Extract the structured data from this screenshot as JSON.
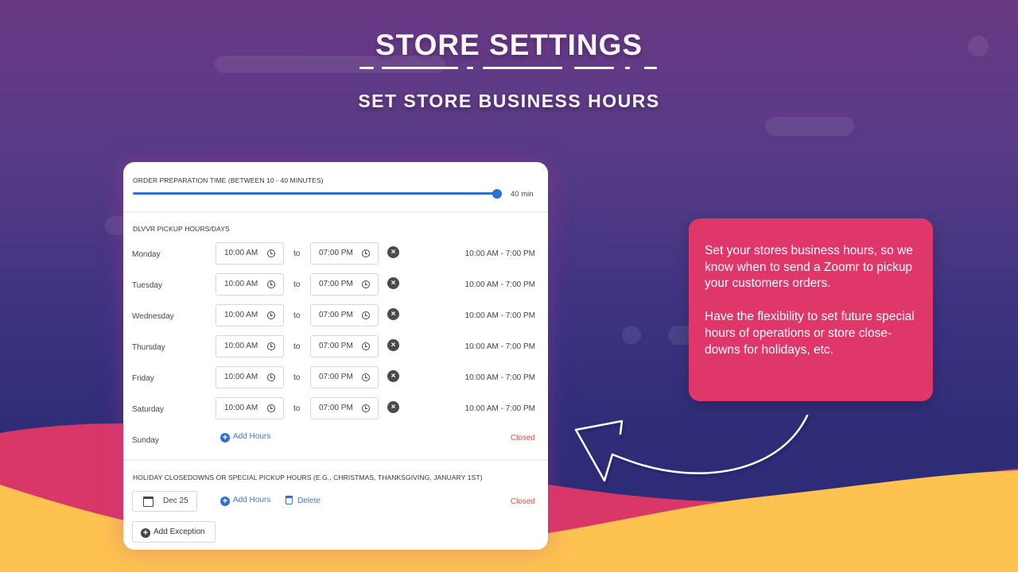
{
  "header": {
    "title": "STORE SETTINGS",
    "subtitle": "SET STORE BUSINESS HOURS"
  },
  "colors": {
    "accent_blue": "#2e6fd0",
    "closed_red": "#e04c3c",
    "callout_pink": "#e0376b",
    "wave_yellow": "#fec250",
    "wave_pink": "#d93768"
  },
  "prep_time": {
    "label": "ORDER PREPARATION TIME (BETWEEN 10 - 40 MINUTES)",
    "min": 10,
    "max": 40,
    "value": 40,
    "value_label": "40 min"
  },
  "pickup": {
    "label": "DLVVR PICKUP HOURS/DAYS",
    "to_label": "to",
    "remove_icon": "close-circle-icon",
    "days": [
      {
        "name": "Monday",
        "open": "10:00 AM",
        "close": "07:00 PM",
        "summary": "10:00 AM - 7:00 PM"
      },
      {
        "name": "Tuesday",
        "open": "10:00 AM",
        "close": "07:00 PM",
        "summary": "10:00 AM - 7:00 PM"
      },
      {
        "name": "Wednesday",
        "open": "10:00 AM",
        "close": "07:00 PM",
        "summary": "10:00 AM - 7:00 PM"
      },
      {
        "name": "Thursday",
        "open": "10:00 AM",
        "close": "07:00 PM",
        "summary": "10:00 AM - 7:00 PM"
      },
      {
        "name": "Friday",
        "open": "10:00 AM",
        "close": "07:00 PM",
        "summary": "10:00 AM - 7:00 PM"
      },
      {
        "name": "Saturday",
        "open": "10:00 AM",
        "close": "07:00 PM",
        "summary": "10:00 AM - 7:00 PM"
      }
    ],
    "sunday": {
      "name": "Sunday",
      "add_hours": "Add Hours",
      "status": "Closed"
    }
  },
  "holidays": {
    "label": "HOLIDAY CLOSEDOWNS OR SPECIAL PICKUP HOURS (E.G., CHRISTMAS, THANKSGIVING, JANUARY 1ST)",
    "date": "Dec 25",
    "add_hours": "Add Hours",
    "delete": "Delete",
    "status": "Closed",
    "add_exception": "Add Exception"
  },
  "callout": {
    "para1": "Set your stores business hours, so we know when to send a Zoomr to pickup your customers orders.",
    "para2": "Have the flexibility to set future special hours of operations or store close-downs for holidays, etc."
  }
}
